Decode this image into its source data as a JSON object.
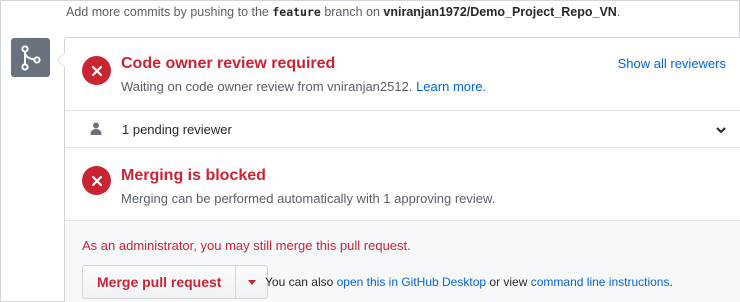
{
  "header": {
    "prefix": "Add more commits by pushing to the",
    "branch": "feature",
    "middle": "branch on",
    "repo": "vniranjan1972/Demo_Project_Repo_VN",
    "suffix": "."
  },
  "review": {
    "title": "Code owner review required",
    "description": "Waiting on code owner review from vniranjan2512.",
    "learn_more": "Learn more.",
    "show_all": "Show all reviewers"
  },
  "pending": {
    "label": "1 pending reviewer"
  },
  "blocked": {
    "title": "Merging is blocked",
    "description": "Merging can be performed automatically with 1 approving review."
  },
  "admin": {
    "notice": "As an administrator, you may still merge this pull request.",
    "merge_button": "Merge pull request",
    "also_prefix": "You can also",
    "desktop_link": "open this in GitHub Desktop",
    "also_middle": "or view",
    "cli_link": "command line instructions",
    "also_suffix": "."
  },
  "colors": {
    "error": "#cb2431",
    "link": "#0366d6",
    "icon_bg": "#6a737d"
  },
  "icons": {
    "merge": "git-merge-icon",
    "x": "x-circle-icon",
    "person": "person-icon",
    "chevron": "chevron-down-icon",
    "caret": "caret-down-icon"
  }
}
